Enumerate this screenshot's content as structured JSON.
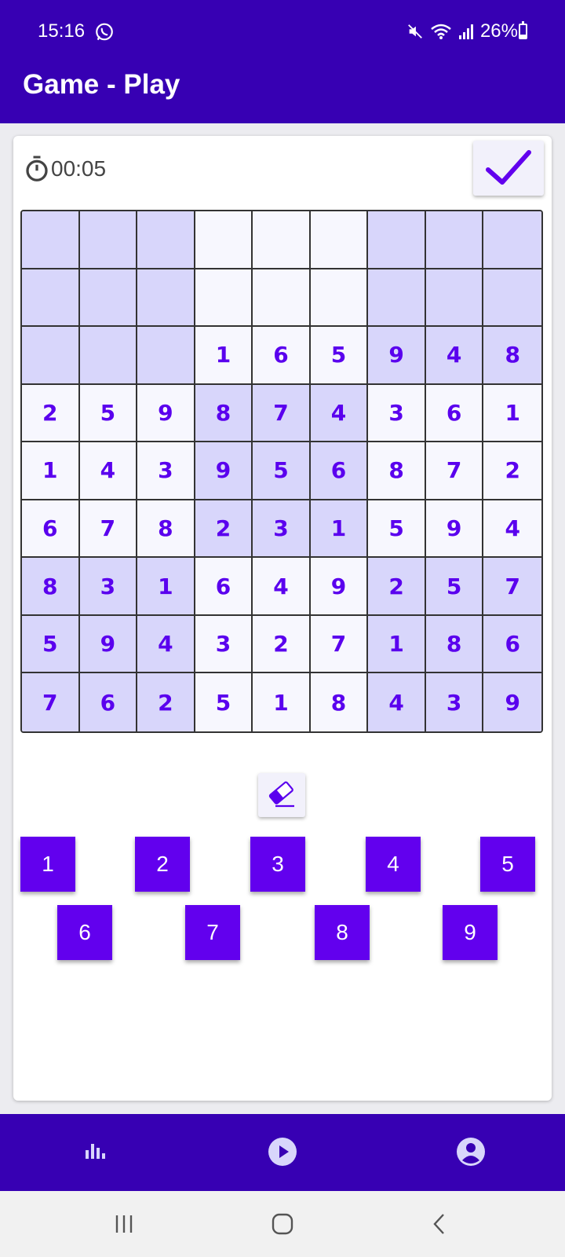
{
  "status_bar": {
    "time": "15:16",
    "battery": "26%",
    "battery_level": 0.26,
    "icons": [
      "whatsapp-icon",
      "mute-icon",
      "wifi-icon",
      "signal-icon",
      "battery-icon"
    ]
  },
  "app_bar": {
    "title": "Game - Play"
  },
  "timer": {
    "value": "00:05",
    "icon": "stopwatch-icon"
  },
  "submit": {
    "icon": "check-icon"
  },
  "board": {
    "rows": [
      [
        "",
        "",
        "",
        "",
        "",
        "",
        "",
        "",
        ""
      ],
      [
        "",
        "",
        "",
        "",
        "",
        "",
        "",
        "",
        ""
      ],
      [
        "",
        "",
        "",
        "1",
        "6",
        "5",
        "9",
        "4",
        "8"
      ],
      [
        "2",
        "5",
        "9",
        "8",
        "7",
        "4",
        "3",
        "6",
        "1"
      ],
      [
        "1",
        "4",
        "3",
        "9",
        "5",
        "6",
        "8",
        "7",
        "2"
      ],
      [
        "6",
        "7",
        "8",
        "2",
        "3",
        "1",
        "5",
        "9",
        "4"
      ],
      [
        "8",
        "3",
        "1",
        "6",
        "4",
        "9",
        "2",
        "5",
        "7"
      ],
      [
        "5",
        "9",
        "4",
        "3",
        "2",
        "7",
        "1",
        "8",
        "6"
      ],
      [
        "7",
        "6",
        "2",
        "5",
        "1",
        "8",
        "4",
        "3",
        "9"
      ]
    ],
    "shade_color": "#d8d6fb",
    "light_color": "#f7f7fe",
    "digit_color": "#5a00ee"
  },
  "eraser": {
    "icon": "eraser-icon"
  },
  "keypad": {
    "row1": [
      "1",
      "2",
      "3",
      "4",
      "5"
    ],
    "row2": [
      "6",
      "7",
      "8",
      "9"
    ],
    "button_color": "#6200ee"
  },
  "bottom_nav": {
    "items": [
      {
        "icon": "stats-icon"
      },
      {
        "icon": "play-icon"
      },
      {
        "icon": "account-icon"
      }
    ]
  },
  "system_nav": {
    "items": [
      "recents-icon",
      "home-icon",
      "back-icon"
    ]
  },
  "colors": {
    "primary_dark": "#3700b3",
    "accent": "#6200ee"
  }
}
